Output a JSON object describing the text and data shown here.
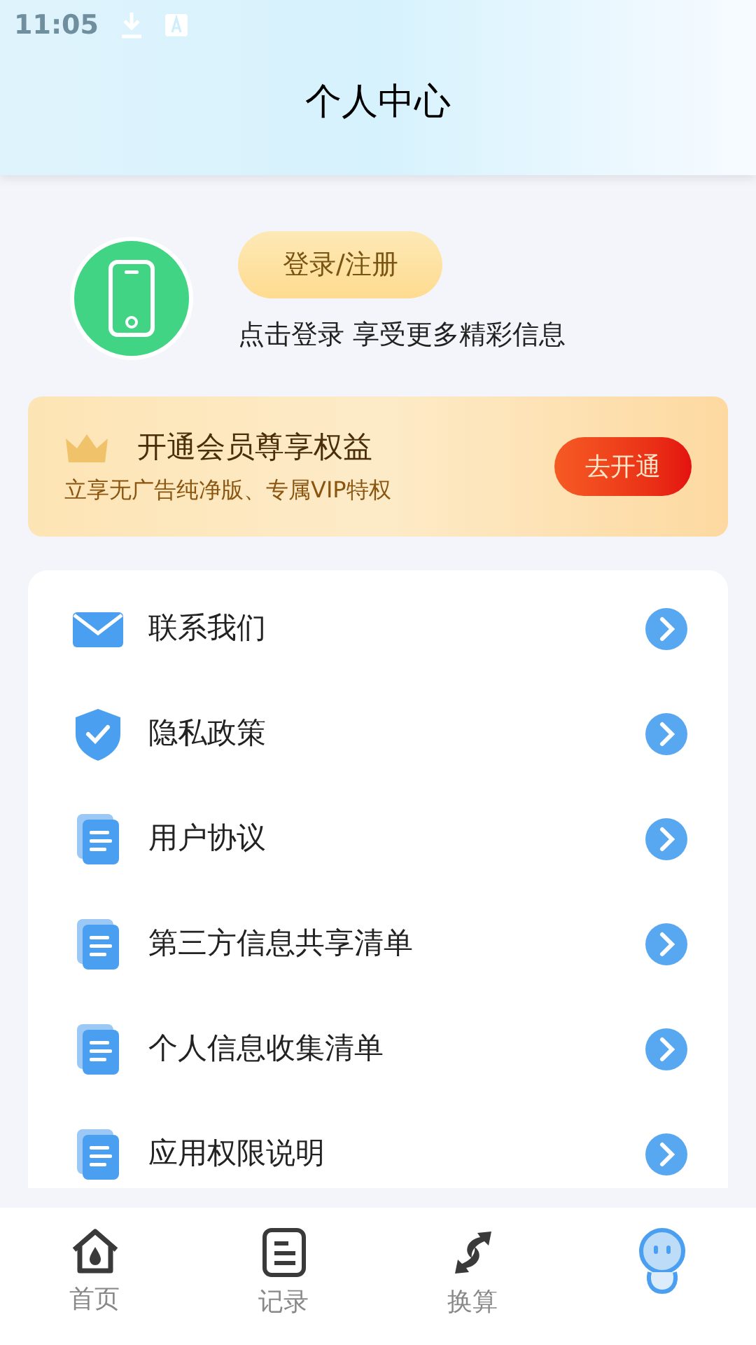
{
  "status_bar": {
    "time": "11:05"
  },
  "header": {
    "title": "个人中心"
  },
  "profile": {
    "login_button": "登录/注册",
    "subtitle": "点击登录 享受更多精彩信息"
  },
  "vip_banner": {
    "title": "开通会员尊享权益",
    "subtitle": "立享无广告纯净版、专属VIP特权",
    "button": "去开通"
  },
  "menu": [
    {
      "kind": "mail",
      "label": "联系我们"
    },
    {
      "kind": "shield",
      "label": "隐私政策"
    },
    {
      "kind": "doc",
      "label": "用户协议"
    },
    {
      "kind": "doc",
      "label": "第三方信息共享清单"
    },
    {
      "kind": "doc",
      "label": "个人信息收集清单"
    },
    {
      "kind": "doc",
      "label": "应用权限说明"
    }
  ],
  "tabs": [
    {
      "kind": "home",
      "label": "首页",
      "selected": false
    },
    {
      "kind": "record",
      "label": "记录",
      "selected": false
    },
    {
      "kind": "convert",
      "label": "换算",
      "selected": false
    },
    {
      "kind": "mine",
      "selected": true
    }
  ]
}
